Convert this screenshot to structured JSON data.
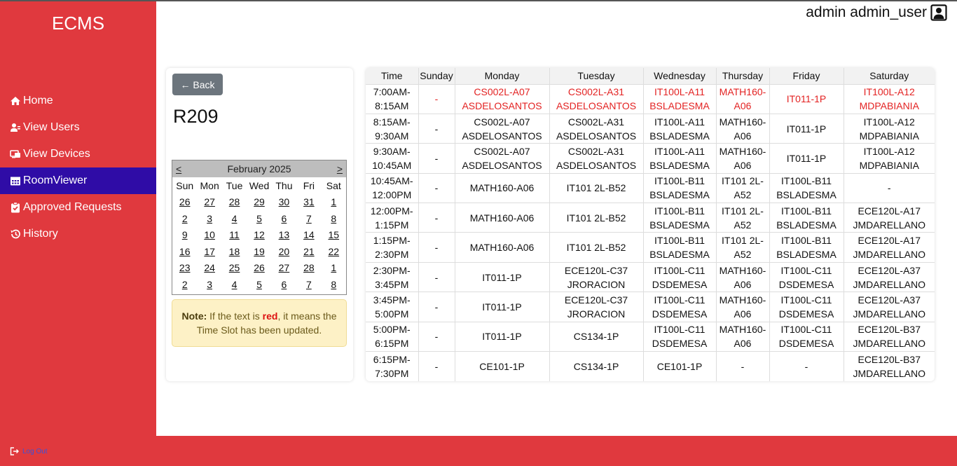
{
  "app": {
    "brand": "ECMS"
  },
  "user": {
    "display": "admin admin_user"
  },
  "nav": {
    "items": [
      {
        "id": "home",
        "label": "Home"
      },
      {
        "id": "users",
        "label": "View Users"
      },
      {
        "id": "devices",
        "label": "View Devices"
      },
      {
        "id": "roomviewer",
        "label": "RoomViewer",
        "active": true
      },
      {
        "id": "approved",
        "label": "Approved Requests"
      },
      {
        "id": "history",
        "label": "History"
      }
    ],
    "logout": "Log Out"
  },
  "room": {
    "back_label": "← Back",
    "name": "R209"
  },
  "calendar": {
    "prev": "<",
    "next": ">",
    "month": "February 2025",
    "days_of_week": [
      "Sun",
      "Mon",
      "Tue",
      "Wed",
      "Thu",
      "Fri",
      "Sat"
    ],
    "weeks": [
      [
        "26",
        "27",
        "28",
        "29",
        "30",
        "31",
        "1"
      ],
      [
        "2",
        "3",
        "4",
        "5",
        "6",
        "7",
        "8"
      ],
      [
        "9",
        "10",
        "11",
        "12",
        "13",
        "14",
        "15"
      ],
      [
        "16",
        "17",
        "18",
        "19",
        "20",
        "21",
        "22"
      ],
      [
        "23",
        "24",
        "25",
        "26",
        "27",
        "28",
        "1"
      ],
      [
        "2",
        "3",
        "4",
        "5",
        "6",
        "7",
        "8"
      ]
    ]
  },
  "note": {
    "label": "Note:",
    "text_before": "If the text is",
    "red_word": "red",
    "text_after": ", it means the Time Slot has been updated."
  },
  "schedule": {
    "headers": [
      "Time",
      "Sunday",
      "Monday",
      "Tuesday",
      "Wednesday",
      "Thursday",
      "Friday",
      "Saturday"
    ],
    "rows": [
      {
        "time": "7:00AM-8:15AM",
        "cells": [
          "-",
          "CS002L-A07 ASDELOSANTOS",
          "CS002L-A31 ASDELOSANTOS",
          "IT100L-A11 BSLADESMA",
          "MATH160-A06",
          "IT011-1P",
          "IT100L-A12 MDPABIANIA"
        ],
        "updated": true
      },
      {
        "time": "8:15AM-9:30AM",
        "cells": [
          "-",
          "CS002L-A07 ASDELOSANTOS",
          "CS002L-A31 ASDELOSANTOS",
          "IT100L-A11 BSLADESMA",
          "MATH160-A06",
          "IT011-1P",
          "IT100L-A12 MDPABIANIA"
        ]
      },
      {
        "time": "9:30AM-10:45AM",
        "cells": [
          "-",
          "CS002L-A07 ASDELOSANTOS",
          "CS002L-A31 ASDELOSANTOS",
          "IT100L-A11 BSLADESMA",
          "MATH160-A06",
          "IT011-1P",
          "IT100L-A12 MDPABIANIA"
        ]
      },
      {
        "time": "10:45AM-12:00PM",
        "cells": [
          "-",
          "MATH160-A06",
          "IT101 2L-B52",
          "IT100L-B11 BSLADESMA",
          "IT101 2L-A52",
          "IT100L-B11 BSLADESMA",
          "-"
        ]
      },
      {
        "time": "12:00PM-1:15PM",
        "cells": [
          "-",
          "MATH160-A06",
          "IT101 2L-B52",
          "IT100L-B11 BSLADESMA",
          "IT101 2L-A52",
          "IT100L-B11 BSLADESMA",
          "ECE120L-A17 JMDARELLANO"
        ]
      },
      {
        "time": "1:15PM-2:30PM",
        "cells": [
          "-",
          "MATH160-A06",
          "IT101 2L-B52",
          "IT100L-B11 BSLADESMA",
          "IT101 2L-A52",
          "IT100L-B11 BSLADESMA",
          "ECE120L-A17 JMDARELLANO"
        ]
      },
      {
        "time": "2:30PM-3:45PM",
        "cells": [
          "-",
          "IT011-1P",
          "ECE120L-C37 JRORACION",
          "IT100L-C11 DSDEMESA",
          "MATH160-A06",
          "IT100L-C11 DSDEMESA",
          "ECE120L-A37 JMDARELLANO"
        ]
      },
      {
        "time": "3:45PM-5:00PM",
        "cells": [
          "-",
          "IT011-1P",
          "ECE120L-C37 JRORACION",
          "IT100L-C11 DSDEMESA",
          "MATH160-A06",
          "IT100L-C11 DSDEMESA",
          "ECE120L-A37 JMDARELLANO"
        ]
      },
      {
        "time": "5:00PM-6:15PM",
        "cells": [
          "-",
          "IT011-1P",
          "CS134-1P",
          "IT100L-C11 DSDEMESA",
          "MATH160-A06",
          "IT100L-C11 DSDEMESA",
          "ECE120L-B37 JMDARELLANO"
        ]
      },
      {
        "time": "6:15PM-7:30PM",
        "cells": [
          "-",
          "CE101-1P",
          "CS134-1P",
          "CE101-1P",
          "-",
          "-",
          "ECE120L-B37 JMDARELLANO"
        ]
      }
    ]
  },
  "colors": {
    "sidebar": "#e0393e",
    "active_nav": "#2f0ca6",
    "updated_text": "#e32222"
  }
}
